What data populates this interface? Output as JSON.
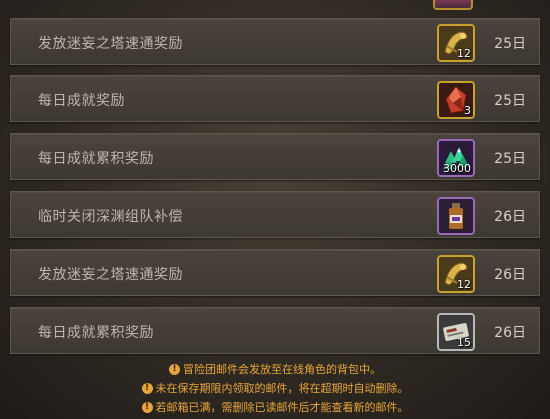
{
  "mails": [
    {
      "title": "发放迷妄之塔速通奖励",
      "date": "25日",
      "item_icon": "gold-horn-icon",
      "count": "12",
      "rarity": "gold"
    },
    {
      "title": "每日成就奖励",
      "date": "25日",
      "item_icon": "red-crystal-icon",
      "count": "3",
      "rarity": "gold"
    },
    {
      "title": "每日成就累积奖励",
      "date": "25日",
      "item_icon": "green-gem-pile-icon",
      "count": "3000",
      "rarity": "purple"
    },
    {
      "title": "临时关闭深渊组队补偿",
      "date": "26日",
      "item_icon": "potion-bottle-icon",
      "count": "",
      "rarity": "purple"
    },
    {
      "title": "发放迷妄之塔速通奖励",
      "date": "26日",
      "item_icon": "gold-horn-icon",
      "count": "12",
      "rarity": "gold"
    },
    {
      "title": "每日成就累积奖励",
      "date": "26日",
      "item_icon": "ticket-icon",
      "count": "15",
      "rarity": "white"
    }
  ],
  "notices": [
    "冒险团邮件会发放至在线角色的背包中。",
    "未在保存期限内领取的邮件，将在超期时自动删除。",
    "若邮箱已满，需删除已读邮件后才能查看新的邮件。"
  ],
  "colors": {
    "row_bg": "#4b443d",
    "title_text": "#bcb6ad",
    "notice_text": "#e8a63a",
    "gold_border": "#c9a22e",
    "purple_border": "#9a6ab8"
  }
}
